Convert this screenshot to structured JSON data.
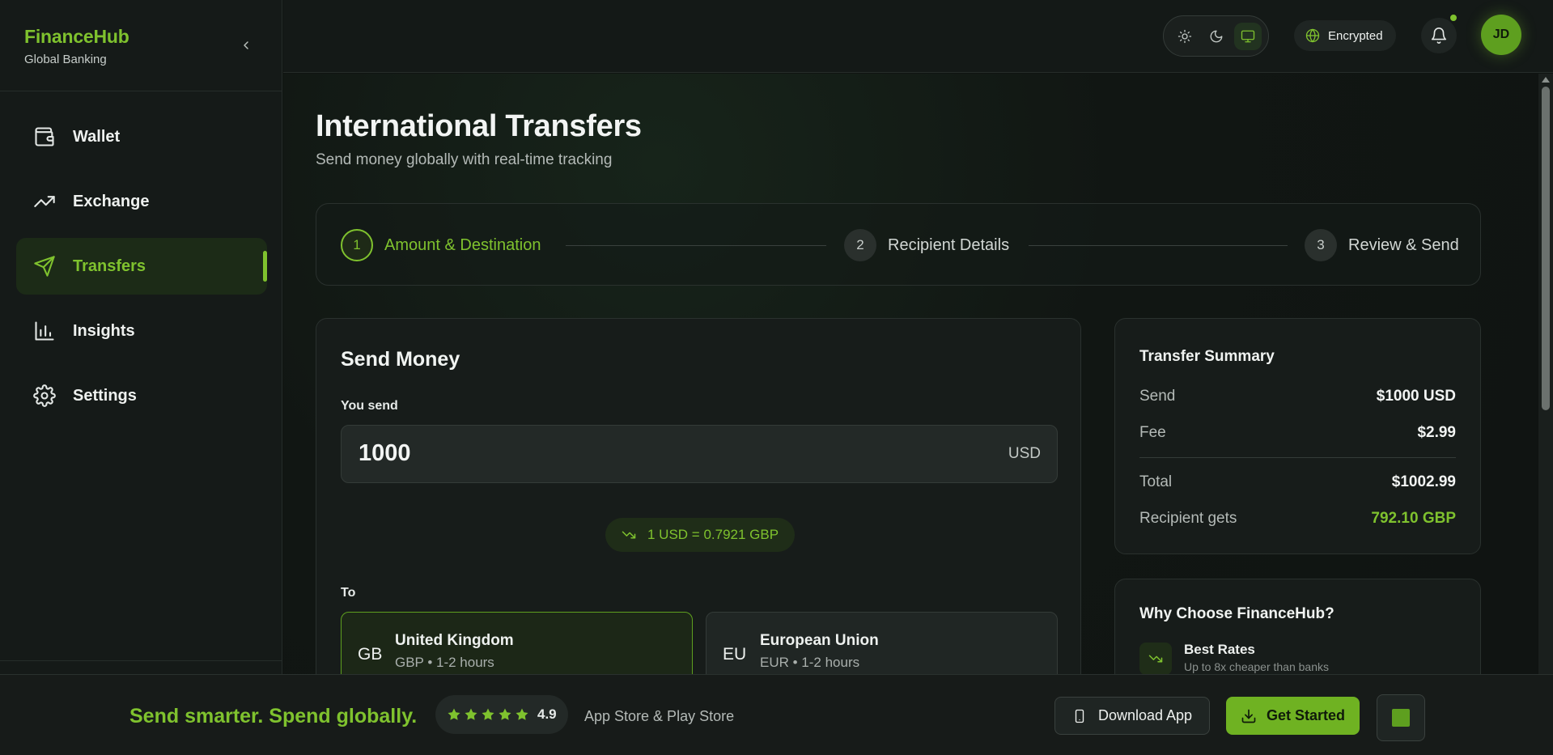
{
  "brand": {
    "name": "FinanceHub",
    "subtitle": "Global Banking"
  },
  "sidebar": {
    "items": [
      {
        "label": "Wallet",
        "icon": "wallet-icon",
        "active": false
      },
      {
        "label": "Exchange",
        "icon": "trending-up-icon",
        "active": false
      },
      {
        "label": "Transfers",
        "icon": "send-icon",
        "active": true
      },
      {
        "label": "Insights",
        "icon": "bar-chart-icon",
        "active": false
      },
      {
        "label": "Settings",
        "icon": "gear-icon",
        "active": false
      }
    ]
  },
  "header": {
    "theme_options": [
      "light",
      "dark",
      "system"
    ],
    "theme_selected": "system",
    "security_badge": "Encrypted",
    "notifications_unread": true,
    "user_initials": "JD"
  },
  "page": {
    "title": "International Transfers",
    "subtitle": "Send money globally with real-time tracking"
  },
  "steps": [
    {
      "number": "1",
      "label": "Amount & Destination",
      "active": true
    },
    {
      "number": "2",
      "label": "Recipient Details",
      "active": false
    },
    {
      "number": "3",
      "label": "Review & Send",
      "active": false
    }
  ],
  "send_money": {
    "title": "Send Money",
    "you_send_label": "You send",
    "amount": "1000",
    "currency": "USD",
    "rate": "1 USD = 0.7921 GBP",
    "to_label": "To",
    "destinations": [
      {
        "code": "GB",
        "name": "United Kingdom",
        "meta": "GBP • 1-2 hours",
        "selected": true
      },
      {
        "code": "EU",
        "name": "European Union",
        "meta": "EUR • 1-2 hours",
        "selected": false
      }
    ]
  },
  "summary": {
    "title": "Transfer Summary",
    "rows": [
      {
        "label": "Send",
        "value": "$1000 USD"
      },
      {
        "label": "Fee",
        "value": "$2.99"
      },
      {
        "label": "Total",
        "value": "$1002.99"
      },
      {
        "label": "Recipient gets",
        "value": "792.10 GBP"
      }
    ]
  },
  "why": {
    "title": "Why Choose FinanceHub?",
    "items": [
      {
        "title": "Best Rates",
        "description": "Up to 8x cheaper than banks"
      }
    ]
  },
  "promo": {
    "tagline": "Send smarter. Spend globally.",
    "rating": "4.9",
    "stars": 5,
    "stores": "App Store & Play Store",
    "download_label": "Download App",
    "cta_label": "Get Started"
  },
  "colors": {
    "accent": "#7fc22e",
    "background": "#101412",
    "card": "#171c1a"
  }
}
